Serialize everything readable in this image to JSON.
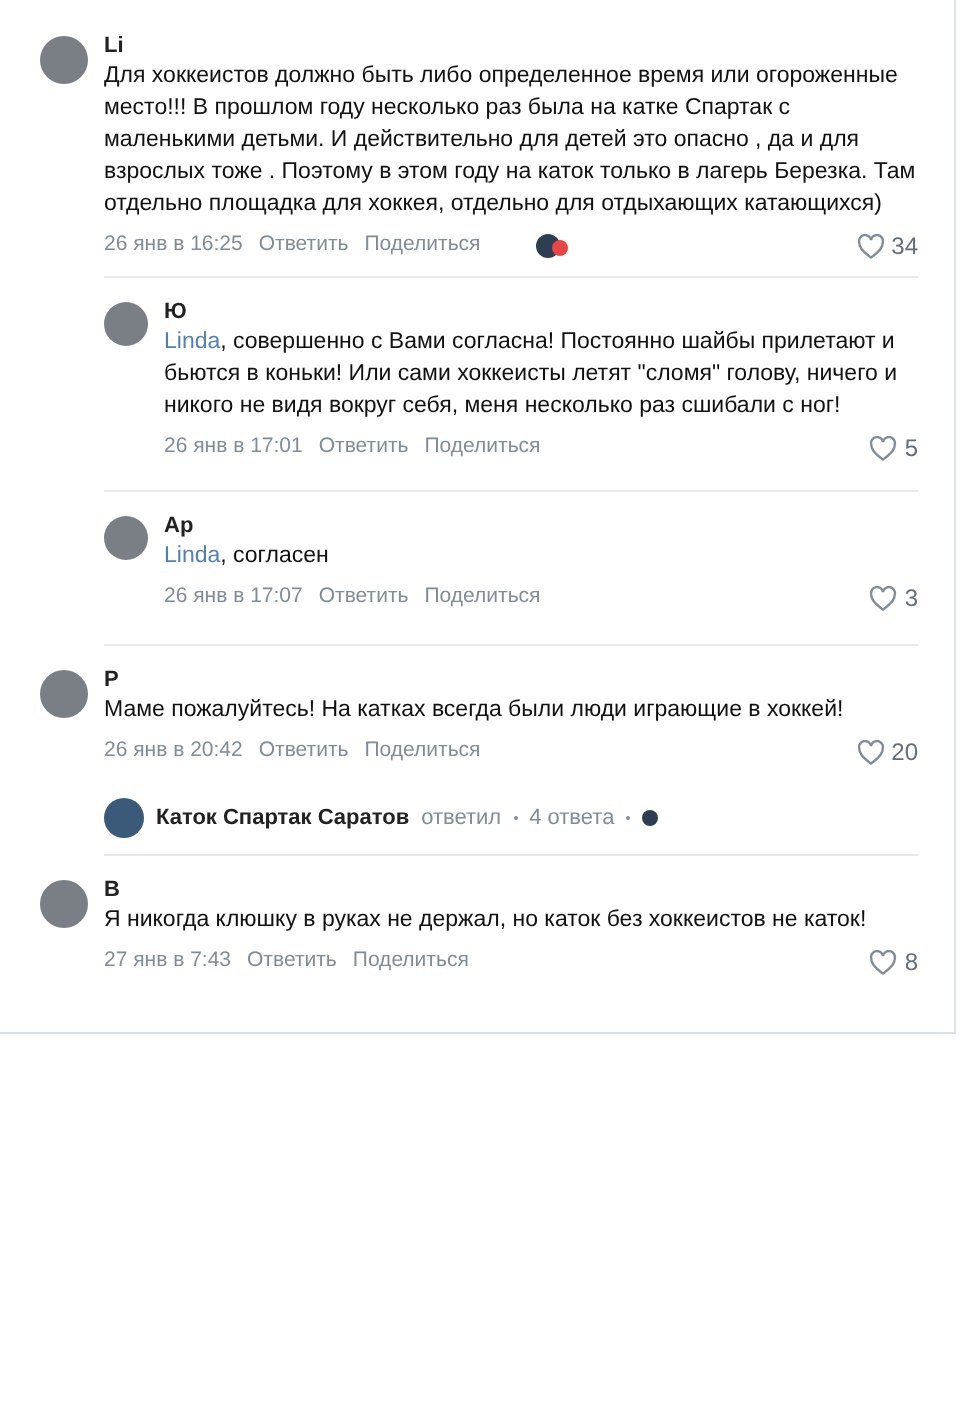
{
  "comments": [
    {
      "author": "Li",
      "text": "Для хоккеистов должно быть либо определенное время или огороженные место!!! В прошлом году несколько раз была на катке Спартак с маленькими детьми. И действительно для детей это опасно , да и для взрослых тоже . Поэтому в этом году на каток только в лагерь Березка. Там отдельно площадка для хоккея, отдельно для отдыхающих катающихся)",
      "date": "26 янв в 16:25",
      "reply": "Ответить",
      "share": "Поделиться",
      "reactions": true,
      "likes": "34",
      "children": [
        {
          "author": "Ю",
          "mention": "Linda",
          "text": ", совершенно с Вами согласна! Постоянно шайбы прилетают и бьются в коньки! Или сами хоккеисты летят \"сломя\" голову, ничего и никого не видя вокруг себя, меня несколько раз сшибали с ног!",
          "date": "26 янв в 17:01",
          "reply": "Ответить",
          "share": "Поделиться",
          "likes": "5"
        },
        {
          "author": "Ар",
          "mention": "Linda",
          "text": ", согласен",
          "date": "26 янв в 17:07",
          "reply": "Ответить",
          "share": "Поделиться",
          "likes": "3"
        }
      ]
    },
    {
      "author": "Р",
      "text": "Маме пожалуйтесь! На катках всегда были люди играющие в хоккей!",
      "date": "26 янв в 20:42",
      "reply": "Ответить",
      "share": "Поделиться",
      "likes": "20",
      "thread": {
        "author": "Каток Спартак Саратов",
        "action": "ответил",
        "count": "4 ответа"
      }
    },
    {
      "author": "В",
      "text": "Я никогда клюшку в руках не держал, но каток без хоккеистов не каток!",
      "date": "27 янв в 7:43",
      "reply": "Ответить",
      "share": "Поделиться",
      "likes": "8"
    }
  ]
}
